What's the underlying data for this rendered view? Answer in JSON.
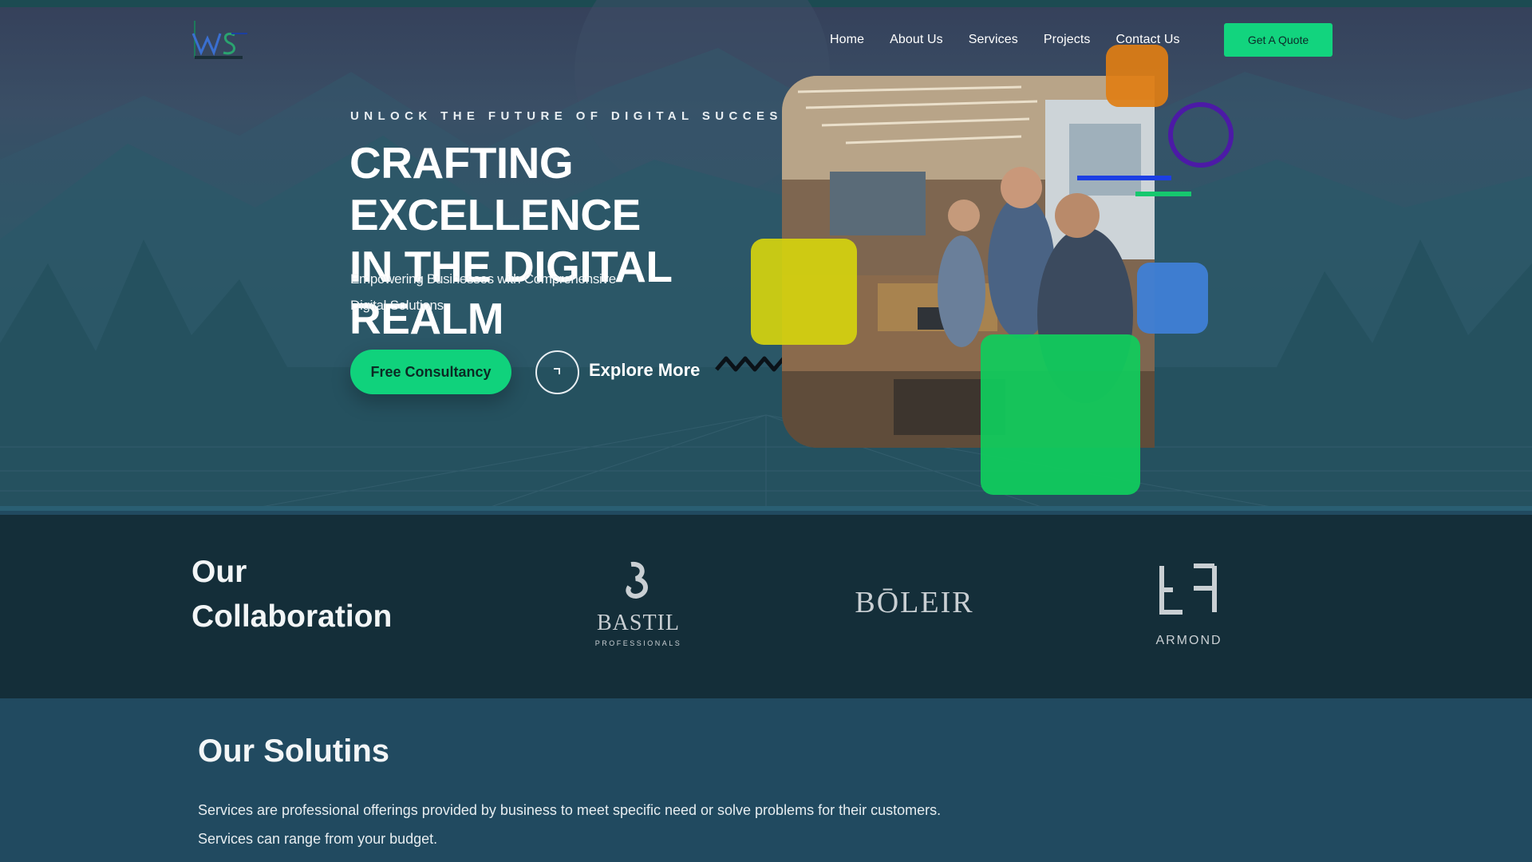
{
  "logo": {
    "alt": "WS logo"
  },
  "nav": {
    "items": [
      {
        "label": "Home"
      },
      {
        "label": "About Us"
      },
      {
        "label": "Services"
      },
      {
        "label": "Projects"
      },
      {
        "label": "Contact Us"
      }
    ],
    "quote_label": "Get A Quote"
  },
  "hero": {
    "eyebrow": "UNLOCK THE FUTURE OF DIGITAL SUCCESS",
    "headline_line1": "CRAFTING EXCELLENCE",
    "headline_line2": "IN THE DIGITAL REALM",
    "subline": "Empowering Businesses with Comprehensive Digital Solutions",
    "cta_label": "Free Consultancy",
    "explore_label": "Explore More"
  },
  "collaboration": {
    "title_line1": "Our",
    "title_line2": "Collaboration",
    "partners": [
      {
        "name": "BASTIL",
        "tagline": "PROFESSIONALS"
      },
      {
        "name": "BŌLEIR"
      },
      {
        "name": "ARMOND"
      }
    ]
  },
  "solutions": {
    "title": "Our Solutins",
    "text_line1": "Services are professional offerings provided by business to meet specific need or solve problems for their customers.",
    "text_line2": "Services can range from your budget."
  },
  "colors": {
    "accent_green": "#10d27c",
    "hero_bg": "#2c5565",
    "collab_bg": "#142e39",
    "solutions_bg": "#214a60",
    "orange": "#e07e14",
    "yellow": "#d5d30e",
    "blue": "#3f7fd6",
    "purple_ring": "#4c1aa6"
  }
}
